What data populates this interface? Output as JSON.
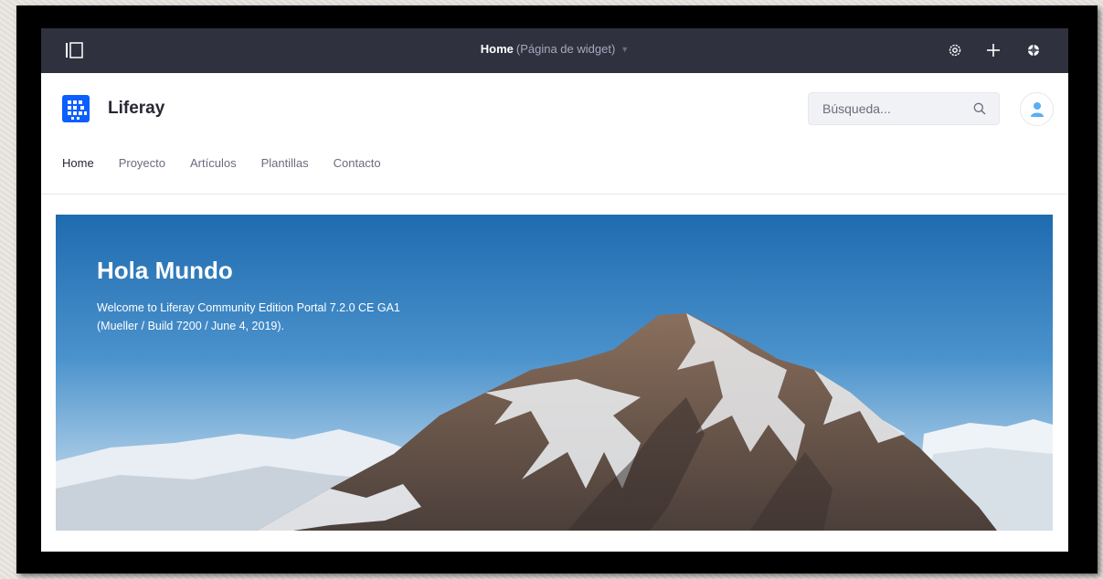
{
  "control_menu": {
    "page_name": "Home",
    "page_type": "(Página de widget)",
    "icons": [
      "product-menu-icon",
      "gear-icon",
      "plus-icon",
      "simulation-icon"
    ]
  },
  "header": {
    "site_name": "Liferay",
    "search": {
      "placeholder": "Búsqueda...",
      "value": ""
    }
  },
  "nav": {
    "items": [
      {
        "label": "Home",
        "active": true
      },
      {
        "label": "Proyecto"
      },
      {
        "label": "Artículos"
      },
      {
        "label": "Plantillas"
      },
      {
        "label": "Contacto"
      }
    ]
  },
  "hero": {
    "title": "Hola Mundo",
    "text_line1": "Welcome to Liferay Community Edition Portal 7.2.0 CE GA1",
    "text_line2": "(Mueller / Build 7200 / June 4, 2019)."
  },
  "colors": {
    "control_menu_bg": "#30313f",
    "brand": "#0b5fff",
    "sky_top": "#1f6bb0",
    "sky_bottom": "#cfe3f3"
  }
}
